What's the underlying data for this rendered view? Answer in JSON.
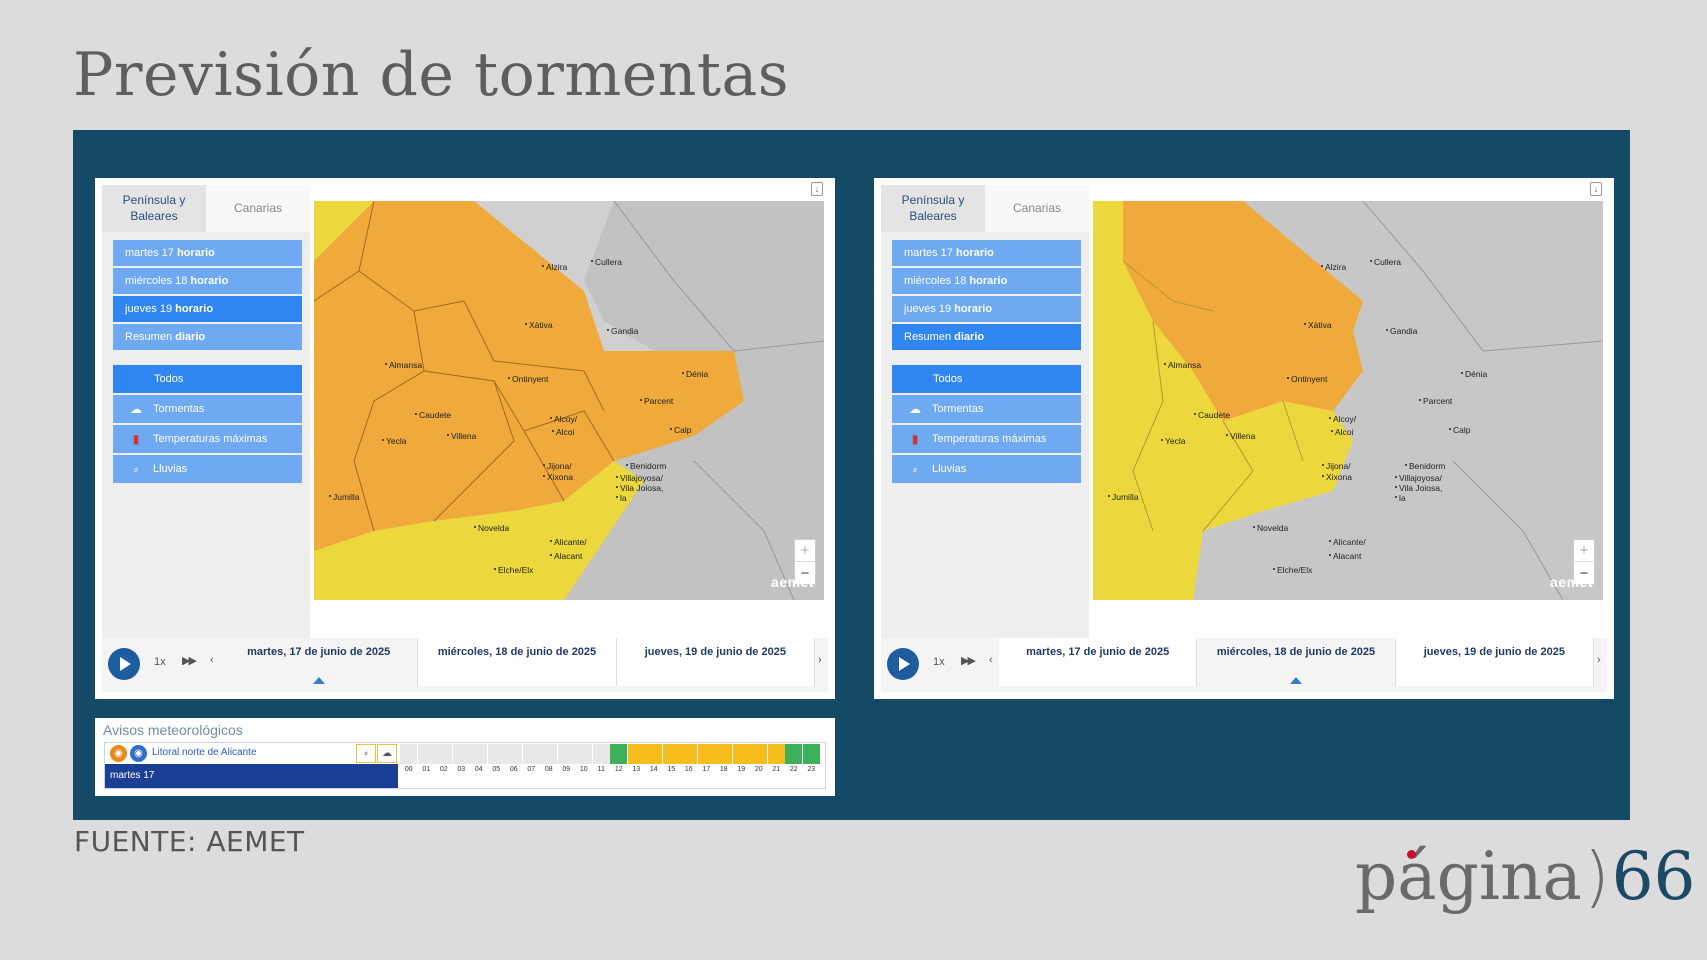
{
  "title": "Previsión de tormentas",
  "source": "FUENTE: AEMET",
  "logo": {
    "text": "página",
    "paren": ")",
    "num": "66"
  },
  "tabs": {
    "peninsula": "Península y Baleares",
    "canarias": "Canarias"
  },
  "days": [
    {
      "name": "martes 17",
      "mode": "horario"
    },
    {
      "name": "miércoles 18",
      "mode": "horario"
    },
    {
      "name": "jueves 19",
      "mode": "horario"
    },
    {
      "name": "Resumen",
      "mode": "diario"
    }
  ],
  "filters": [
    {
      "label": "Todos",
      "icon": ""
    },
    {
      "label": "Tormentas",
      "icon": "storm-icon"
    },
    {
      "label": "Temperaturas máximas",
      "icon": "thermometer-icon"
    },
    {
      "label": "Lluvias",
      "icon": "rain-icon"
    }
  ],
  "timeline": {
    "speed": "1x",
    "dates": [
      "martes, 17 de junio de 2025",
      "miércoles, 18 de junio de 2025",
      "jueves, 19 de junio de 2025"
    ]
  },
  "map": {
    "brand": "aemet",
    "places": [
      "Alzira",
      "Cullera",
      "Xàtiva",
      "Gandia",
      "Almansa",
      "Ontinyent",
      "Dénia",
      "Caudete",
      "Alcoy/",
      "Alcoi",
      "Parcent",
      "Yecla",
      "Villena",
      "Calp",
      "Jijona/",
      "Xixona",
      "Benidorm",
      "Jumilla",
      "Villajoyosa/",
      "Vila Joiosa,",
      "la",
      "Novelda",
      "Alicante/",
      "Alacant",
      "Elche/Elx"
    ],
    "zoom_in": "+",
    "zoom_out": "−"
  },
  "panels": [
    {
      "id": "a",
      "selected_day": 2,
      "selected_date": 0
    },
    {
      "id": "b",
      "selected_day": 3,
      "selected_date": 1
    }
  ],
  "warnings": {
    "title": "Avisos meteorológicos",
    "zone": "Litoral norte de Alicante",
    "day": "martes 17",
    "hours": [
      "00",
      "01",
      "02",
      "03",
      "04",
      "05",
      "06",
      "07",
      "08",
      "09",
      "10",
      "11",
      "12",
      "13",
      "14",
      "15",
      "16",
      "17",
      "18",
      "19",
      "20",
      "21",
      "22",
      "23"
    ],
    "levels": [
      "none",
      "none",
      "none",
      "none",
      "none",
      "none",
      "none",
      "none",
      "none",
      "none",
      "none",
      "none",
      "green",
      "yellow",
      "yellow",
      "yellow",
      "yellow",
      "yellow",
      "yellow",
      "yellow",
      "yellow",
      "yellow",
      "green",
      "green"
    ]
  },
  "colors": {
    "orange": "#f0a93b",
    "yellow": "#ecd83d",
    "grey": "#c4c4c4",
    "dayBtn": "#6fa9f2",
    "dayBtnSel": "#2f86f0",
    "stage": "#144a66"
  }
}
